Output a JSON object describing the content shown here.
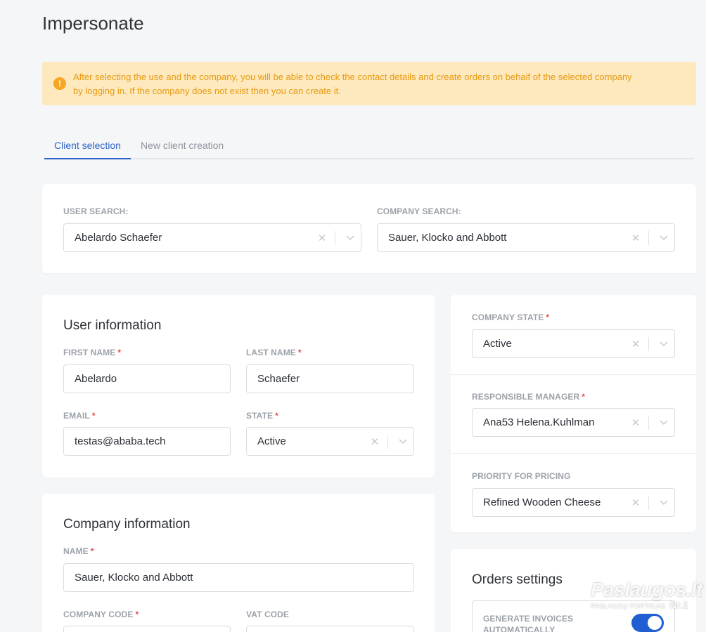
{
  "page": {
    "title": "Impersonate"
  },
  "alert": {
    "icon": "exclamation-icon",
    "line1": "After selecting the use and the company, you will be able to check the contact details and create orders on behaif of the selected company",
    "line2": "by logging in. If the company does not exist then you can create it."
  },
  "tabs": [
    {
      "label": "Client selection",
      "active": true
    },
    {
      "label": "New client creation",
      "active": false
    }
  ],
  "search": {
    "user_label": "USER SEARCH:",
    "user_value": "Abelardo Schaefer",
    "company_label": "COMPANY SEARCH:",
    "company_value": "Sauer, Klocko and Abbott"
  },
  "user_info": {
    "title": "User information",
    "first_name_label": "FIRST NAME",
    "first_name_value": "Abelardo",
    "last_name_label": "LAST NAME",
    "last_name_value": "Schaefer",
    "email_label": "EMAIL",
    "email_value": "testas@ababa.tech",
    "state_label": "STATE",
    "state_value": "Active",
    "required_mark": "*"
  },
  "company_info": {
    "title": "Company information",
    "name_label": "NAME",
    "name_value": "Sauer, Klocko and Abbott",
    "code_label": "COMPANY CODE",
    "vat_label": "VAT CODE"
  },
  "company_settings": {
    "state_label": "COMPANY STATE",
    "state_value": "Active",
    "manager_label": "RESPONSIBLE MANAGER",
    "manager_value": "Ana53 Helena.Kuhlman",
    "pricing_label": "PRIORITY FOR PRICING",
    "pricing_value": "Refined Wooden Cheese"
  },
  "orders": {
    "title": "Orders settings",
    "invoices_label_line1": "GENERATE INVOICES",
    "invoices_label_line2": "AUTOMATICALLY",
    "invoices_enabled": true
  },
  "watermark": {
    "main": "Paslaugos.lt",
    "sub": "PASLAUGŲ PORTALAS",
    "nr": "Nr.1"
  },
  "colors": {
    "accent": "#2c64c8",
    "alert_bg": "#fde9bd",
    "alert_text": "#e89a12",
    "required": "#e24b4b",
    "toggle_on": "#1f5fd1"
  }
}
